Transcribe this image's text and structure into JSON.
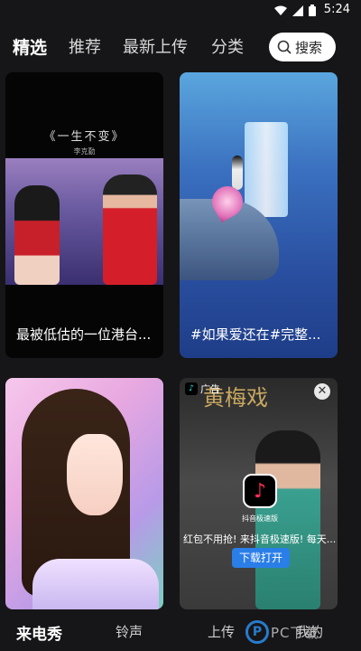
{
  "status_bar": {
    "time": "5:24"
  },
  "tabs": [
    {
      "label": "精选"
    },
    {
      "label": "推荐"
    },
    {
      "label": "最新上传"
    },
    {
      "label": "分类"
    }
  ],
  "search": {
    "label": "搜索"
  },
  "cards": [
    {
      "caption": "最被低估的一位港台...",
      "title": "《一生不变》",
      "subtitle": "李克勤"
    },
    {
      "caption": "#如果爱还在#完整..."
    },
    {
      "caption": ""
    },
    {
      "ad_label": "广告",
      "poster_title": "黄梅戏",
      "app_name": "抖音极速版",
      "promo": "红包不用抢! 来抖音极速版! 每天...",
      "button": "下载打开"
    }
  ],
  "bottom_nav": [
    {
      "label": "来电秀"
    },
    {
      "label": "铃声"
    },
    {
      "label": "上传"
    },
    {
      "label": "我的"
    }
  ],
  "watermark": {
    "text": "PC下载"
  },
  "icons": {
    "wifi": "wifi-icon",
    "signal": "signal-icon",
    "battery": "battery-icon",
    "search": "search-icon",
    "close": "close-icon",
    "tiktok": "tiktok-icon"
  },
  "colors": {
    "background": "#161618",
    "accent_blue": "#2a7ee8",
    "tiktok_red": "#fe2c55"
  }
}
